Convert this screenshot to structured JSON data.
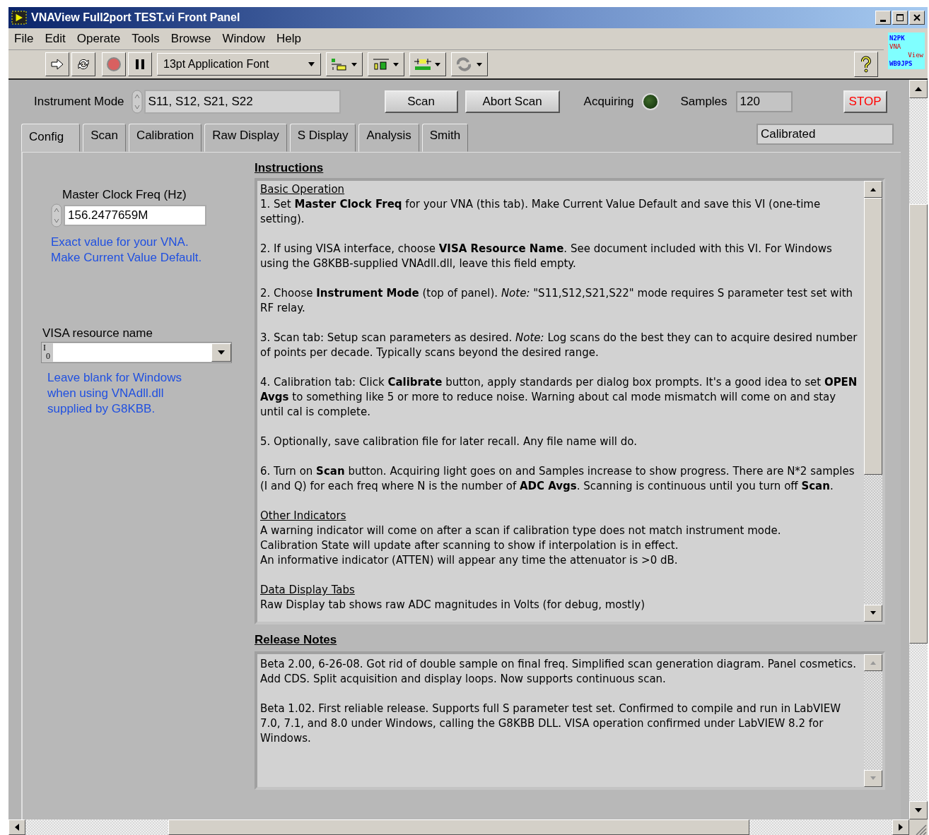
{
  "window": {
    "title": "VNAView Full2port TEST.vi Front Panel"
  },
  "menu": [
    "File",
    "Edit",
    "Operate",
    "Tools",
    "Browse",
    "Window",
    "Help"
  ],
  "toolbar": {
    "font": "13pt Application Font"
  },
  "logo": [
    "N2PK",
    "VNA",
    "View",
    "WB9JPS"
  ],
  "controls": {
    "instrument_mode_label": "Instrument Mode",
    "instrument_mode": "S11, S12, S21, S22",
    "scan_button": "Scan",
    "abort_button": "Abort Scan",
    "acquiring_label": "Acquiring",
    "acquiring_on": false,
    "samples_label": "Samples",
    "samples": "120",
    "stop_button": "STOP",
    "cal_state": "Calibrated"
  },
  "tabs": [
    {
      "label": "Config",
      "selected": true
    },
    {
      "label": "Scan",
      "selected": false
    },
    {
      "label": "Calibration",
      "selected": false
    },
    {
      "label": "Raw Display",
      "selected": false
    },
    {
      "label": "S Display",
      "selected": false
    },
    {
      "label": "Analysis",
      "selected": false
    },
    {
      "label": "Smith",
      "selected": false
    }
  ],
  "config": {
    "clock_label": "Master Clock Freq (Hz)",
    "clock_value": "156.2477659M",
    "clock_note": [
      "Exact value for your VNA.",
      "Make Current Value Default."
    ],
    "visa_label": "VISA resource name",
    "visa_io": [
      "I",
      "0"
    ],
    "visa_note": [
      "Leave blank  for Windows",
      "when using VNAdll.dll",
      "supplied by G8KBB."
    ]
  },
  "instructions": {
    "title": "Instructions",
    "blocks": [
      {
        "kind": "heading",
        "text": "Basic Operation"
      },
      {
        "kind": "para",
        "text": "1. Set **Master Clock Freq** for your VNA (this tab). Make Current Value Default and save this VI (one-time setting)."
      },
      {
        "kind": "para",
        "text": "2. If using VISA interface, choose **VISA Resource Name**. See document included with this VI. For Windows  using the G8KBB-supplied VNAdll.dll, leave this field empty."
      },
      {
        "kind": "para",
        "text": "2. Choose **Instrument Mode** (top of panel). *Note:* \"S11,S12,S21,S22\" mode requires S parameter test set with RF relay."
      },
      {
        "kind": "para",
        "text": "3. Scan tab: Setup scan parameters as desired. *Note:* Log scans do the best they can to acquire desired number of points per decade. Typically scans beyond the desired range."
      },
      {
        "kind": "para",
        "text": "4. Calibration tab:  Click **Calibrate** button, apply standards per dialog box prompts. It's a good idea to set **OPEN Avgs** to something like 5 or more to reduce noise. Warning about cal mode mismatch will come on and stay until cal is complete."
      },
      {
        "kind": "para",
        "text": "5. Optionally, save calibration file for later recall. Any file name will do."
      },
      {
        "kind": "para",
        "text": "6. Turn on **Scan** button. Acquiring light goes on and Samples increase to show progress.  There are N*2 samples (I and Q) for each freq where N is the number of **ADC Avgs**. Scanning is continuous until you turn off **Scan**."
      },
      {
        "kind": "heading",
        "text": "Other Indicators"
      },
      {
        "kind": "line",
        "text": "A warning indicator will come on after a scan if calibration type does not match instrument mode."
      },
      {
        "kind": "line",
        "text": "Calibration State will update after scanning to show if interpolation is in effect."
      },
      {
        "kind": "para",
        "text": "An informative indicator (ATTEN) will appear any time the attenuator is >0 dB."
      },
      {
        "kind": "heading",
        "text": "Data Display Tabs"
      },
      {
        "kind": "line",
        "text": "Raw Display tab shows raw ADC magnitudes in Volts (for debug, mostly)"
      }
    ]
  },
  "release_notes": {
    "title": "Release Notes",
    "blocks": [
      {
        "kind": "para",
        "text": "Beta 2.00, 6-26-08.  Got rid of double sample on final freq. Simplified scan generation diagram. Panel cosmetics.  Add CDS.  Split acquisition and display loops. Now supports continuous scan."
      },
      {
        "kind": "para",
        "text": "Beta 1.02.  First reliable release. Supports full S parameter test set. Confirmed to compile and run in LabVIEW 7.0, 7.1, and 8.0 under Windows, calling the G8KBB DLL. VISA operation confirmed under LabVIEW 8.2 for Windows."
      }
    ]
  }
}
